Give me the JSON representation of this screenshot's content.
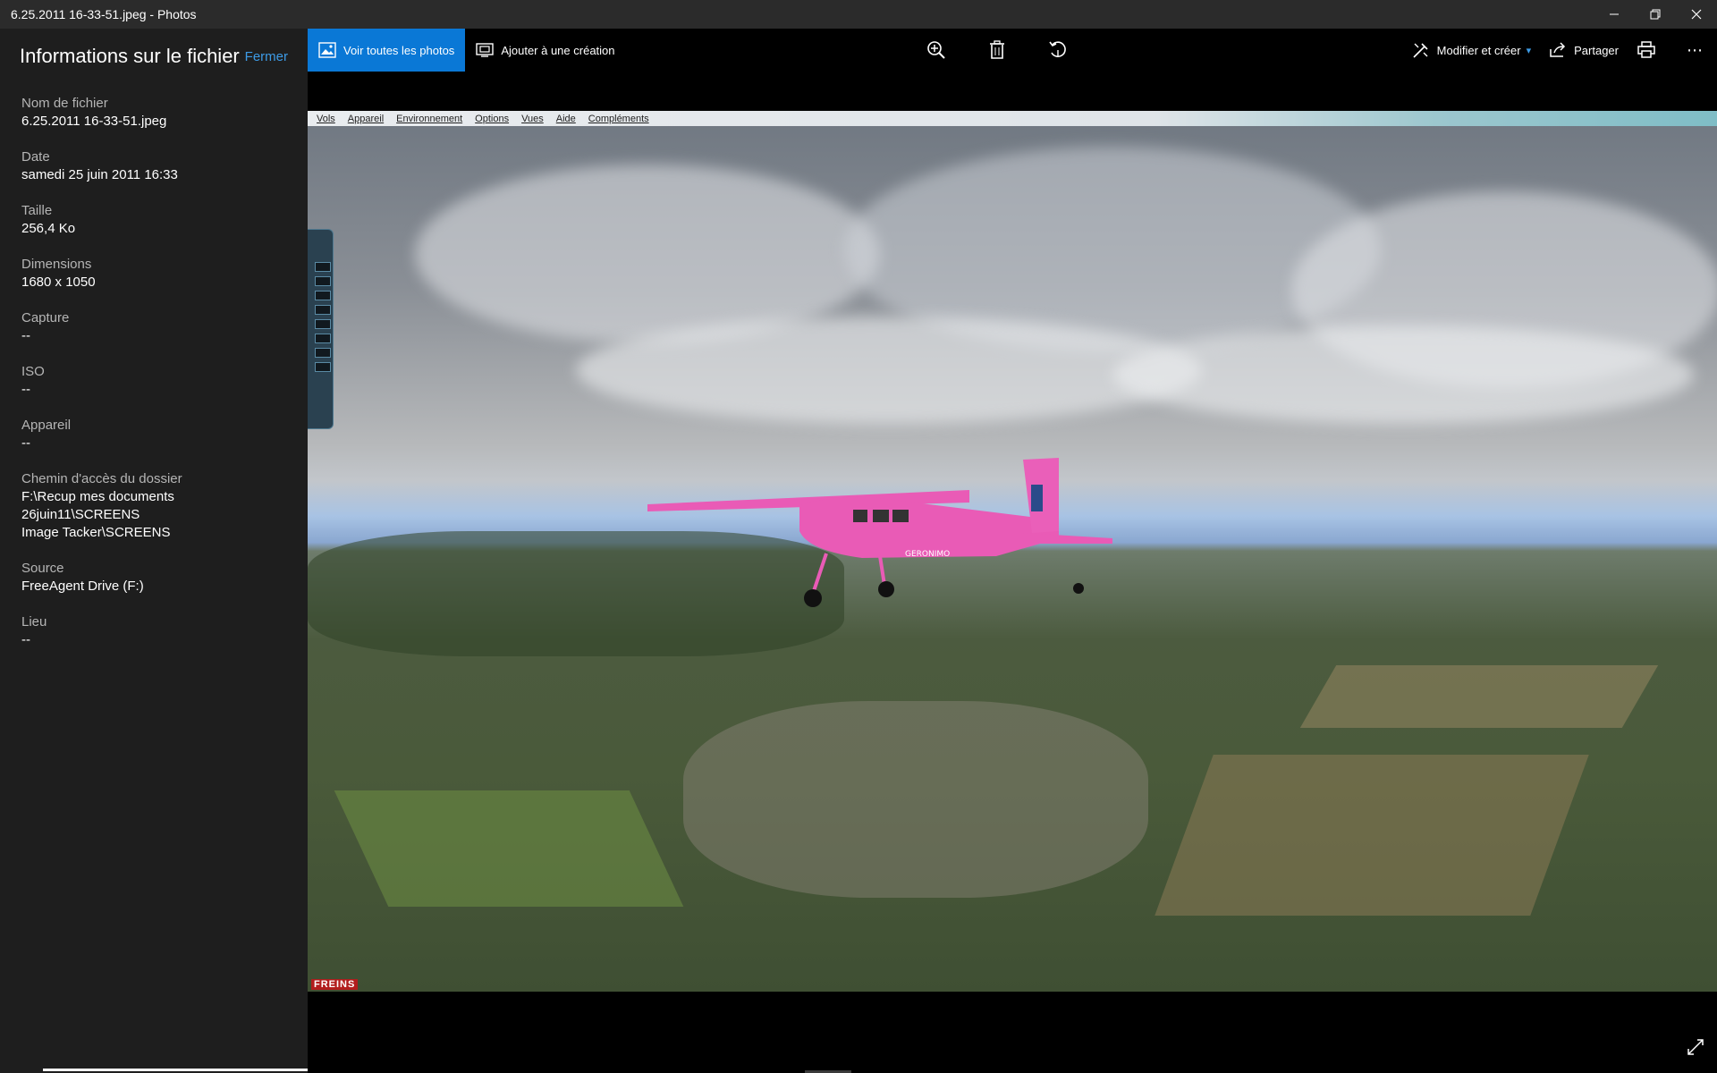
{
  "window": {
    "title": "6.25.2011 16-33-51.jpeg - Photos",
    "controls": [
      "minimize-icon",
      "restore-icon",
      "close-icon"
    ]
  },
  "info_panel": {
    "title": "Informations sur le fichier",
    "close_label": "Fermer",
    "fields": [
      {
        "label": "Nom de fichier",
        "value": "6.25.2011 16-33-51.jpeg"
      },
      {
        "label": "Date",
        "value": "samedi 25 juin 2011 16:33"
      },
      {
        "label": "Taille",
        "value": "256,4 Ko"
      },
      {
        "label": "Dimensions",
        "value": "1680 x 1050"
      },
      {
        "label": "Capture",
        "value": "--"
      },
      {
        "label": "ISO",
        "value": "--"
      },
      {
        "label": "Appareil",
        "value": "--"
      },
      {
        "label": "Chemin d'accès du dossier",
        "value": "F:\\Recup mes documents 26juin11\\SCREENS",
        "value2": "Image Tacker\\SCREENS"
      },
      {
        "label": "Source",
        "value": "FreeAgent Drive (F:)"
      },
      {
        "label": "Lieu",
        "value": "--"
      }
    ]
  },
  "toolbar": {
    "see_all": "Voir toutes les photos",
    "add_to_creation": "Ajouter à une création",
    "center_icons": [
      "zoom-in-icon",
      "delete-icon",
      "rotate-icon"
    ],
    "edit_create": "Modifier et créer",
    "share": "Partager",
    "print_icon": "print-icon",
    "more_icon": "more-icon"
  },
  "photo": {
    "sim_menu": [
      "Vols",
      "Appareil",
      "Environnement",
      "Options",
      "Vues",
      "Aide",
      "Compléments"
    ],
    "brakes_label": "FREINS",
    "colors": {
      "accent": "#0a78d6",
      "link": "#3d9be6",
      "plane": "#e95bb6"
    }
  }
}
